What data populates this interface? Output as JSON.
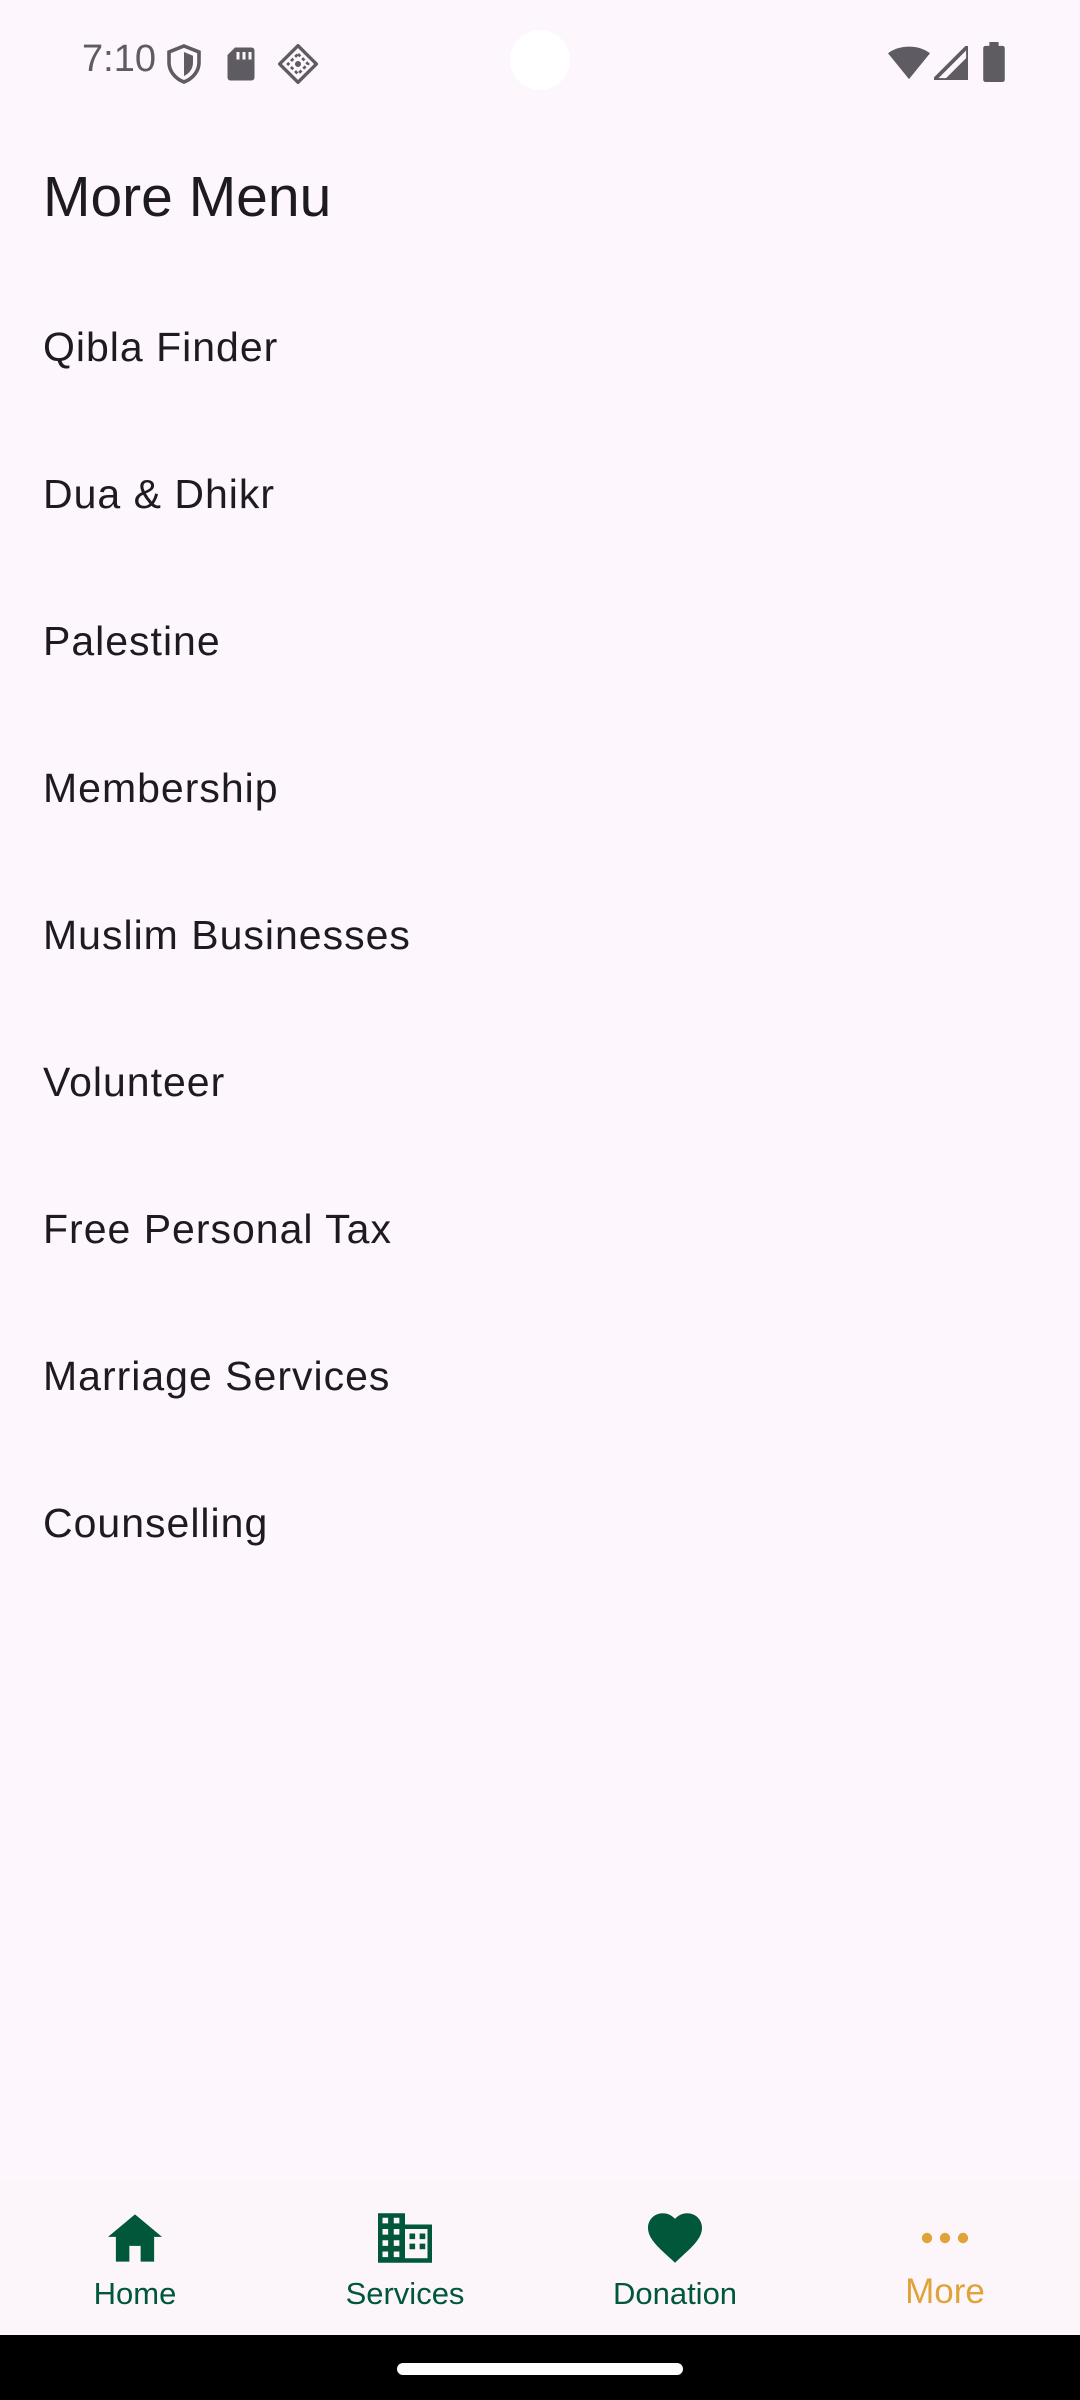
{
  "status_bar": {
    "time": "7:10",
    "icons": [
      "shield-icon",
      "sd-card-icon",
      "nfc-tag-icon",
      "wifi-icon",
      "cellular-signal-icon",
      "battery-icon"
    ]
  },
  "page": {
    "title": "More Menu"
  },
  "menu": {
    "items": [
      {
        "label": "Qibla Finder"
      },
      {
        "label": "Dua & Dhikr"
      },
      {
        "label": "Palestine"
      },
      {
        "label": "Membership"
      },
      {
        "label": "Muslim Businesses"
      },
      {
        "label": "Volunteer"
      },
      {
        "label": "Free Personal Tax"
      },
      {
        "label": "Marriage Services"
      },
      {
        "label": "Counselling"
      }
    ]
  },
  "bottom_nav": {
    "items": [
      {
        "label": "Home",
        "icon": "home-icon"
      },
      {
        "label": "Services",
        "icon": "building-icon"
      },
      {
        "label": "Donation",
        "icon": "heart-icon"
      },
      {
        "label": "More",
        "icon": "more-horiz-icon",
        "active": true
      }
    ]
  },
  "colors": {
    "background": "#fdf6fc",
    "primary": "#00573a",
    "active": "#e0a33a",
    "text": "#1e1b20",
    "status_text": "#5e5b62"
  }
}
